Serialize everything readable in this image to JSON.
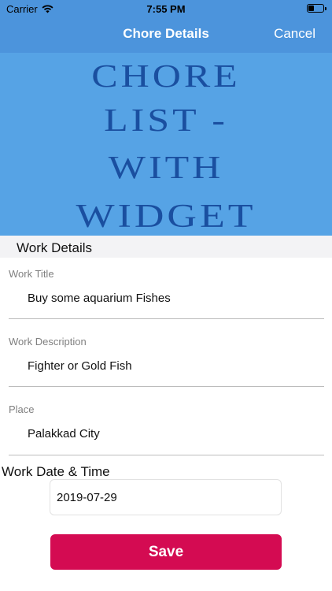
{
  "status_bar": {
    "carrier": "Carrier",
    "time": "7:55 PM"
  },
  "nav": {
    "title": "Chore Details",
    "cancel_label": "Cancel"
  },
  "banner": {
    "lines": [
      "CHORE",
      "LIST -",
      "WITH",
      "WIDGET"
    ]
  },
  "section": {
    "title": "Work Details"
  },
  "fields": [
    {
      "label": "Work Title",
      "value": "Buy some aquarium Fishes"
    },
    {
      "label": "Work Description",
      "value": "Fighter or Gold Fish"
    },
    {
      "label": "Place",
      "value": "Palakkad City"
    }
  ],
  "date": {
    "heading": "Work Date & Time",
    "value": "2019-07-29"
  },
  "save_label": "Save",
  "colors": {
    "nav_bar": "#4c94dc",
    "banner_bg": "#56a3e5",
    "banner_text": "#1a4fa0",
    "save_button": "#d40b52"
  }
}
